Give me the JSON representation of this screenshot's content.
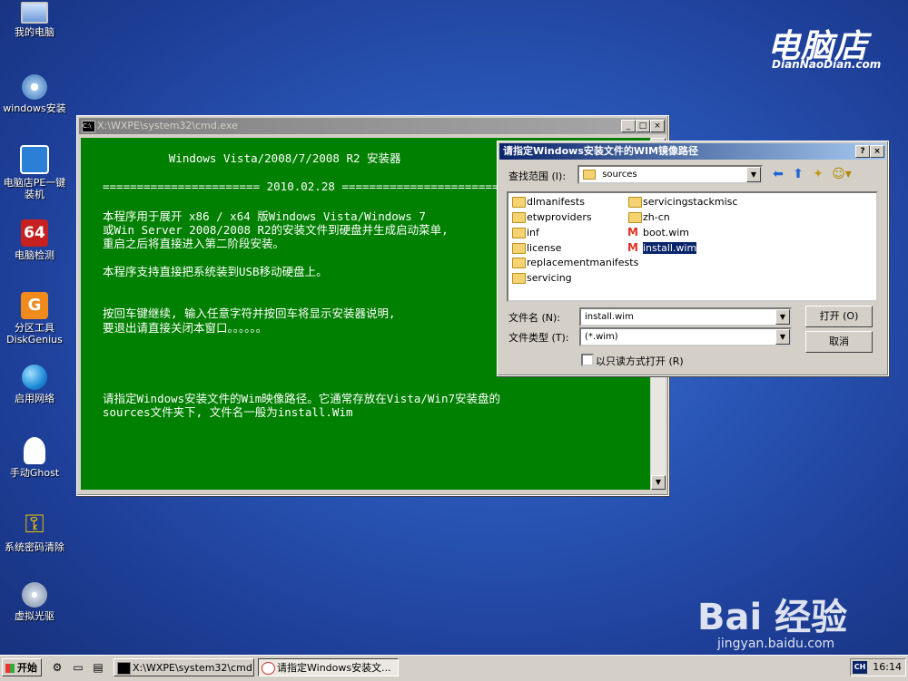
{
  "desktop": {
    "icons": [
      {
        "label": "我的电脑",
        "icon": "computer-icon"
      },
      {
        "label": "windows安装",
        "icon": "disc-installer-icon"
      },
      {
        "label": "电脑店PE一键装机",
        "icon": "ghost-installer-icon"
      },
      {
        "label": "电脑检测",
        "icon": "64-hardware-icon"
      },
      {
        "label": "分区工具DiskGenius",
        "icon": "diskgenius-icon"
      },
      {
        "label": "启用网络",
        "icon": "network-globe-icon"
      },
      {
        "label": "手动Ghost",
        "icon": "ghost-icon"
      },
      {
        "label": "系统密码清除",
        "icon": "key-icon"
      },
      {
        "label": "虚拟光驱",
        "icon": "virtual-drive-icon"
      }
    ],
    "brand_logo": "电脑店",
    "brand_url": "DianNaoDian.com",
    "watermark_main": "Bai 经验",
    "watermark_url": "jingyan.baidu.com"
  },
  "cmd_window": {
    "title": "X:\\WXPE\\system32\\cmd.exe",
    "lines": [
      "           Windows Vista/2008/7/2008 R2 安装器",
      "======================= 2010.02.28 =======================",
      "本程序用于展开 x86 / x64 版Windows Vista/Windows 7",
      "或Win Server 2008/2008 R2的安装文件到硬盘并生成启动菜单,",
      "重启之后将直接进入第二阶段安装。",
      "本程序支持直接把系统装到USB移动硬盘上。",
      "按回车键继续, 输入任意字符并按回车将显示安装器说明,",
      "要退出请直接关闭本窗口。。。。。。",
      "请指定Windows安装文件的Wim映像路径。它通常存放在Vista/Win7安装盘的",
      "sources文件夹下, 文件名一般为install.Wim"
    ]
  },
  "dialog": {
    "title": "请指定Windows安装文件的WIM镜像路径",
    "look_in_label": "查找范围 (I):",
    "look_in_value": "sources",
    "files": [
      {
        "name": "dlmanifests",
        "type": "folder"
      },
      {
        "name": "etwproviders",
        "type": "folder"
      },
      {
        "name": "inf",
        "type": "folder"
      },
      {
        "name": "license",
        "type": "folder"
      },
      {
        "name": "replacementmanifests",
        "type": "folder"
      },
      {
        "name": "servicing",
        "type": "folder"
      },
      {
        "name": "servicingstackmisc",
        "type": "folder"
      },
      {
        "name": "zh-cn",
        "type": "folder"
      },
      {
        "name": "boot.wim",
        "type": "wim"
      },
      {
        "name": "install.wim",
        "type": "wim",
        "selected": true
      }
    ],
    "filename_label": "文件名 (N):",
    "filename_value": "install.wim",
    "filetype_label": "文件类型 (T):",
    "filetype_value": "(*.wim)",
    "readonly_label": "以只读方式打开 (R)",
    "open_button": "打开 (O)",
    "cancel_button": "取消"
  },
  "taskbar": {
    "start_label": "开始",
    "tasks": [
      {
        "label": "X:\\WXPE\\system32\\cmd...."
      },
      {
        "label": "请指定Windows安装文..."
      }
    ],
    "ime": "CH",
    "clock": "16:14"
  }
}
